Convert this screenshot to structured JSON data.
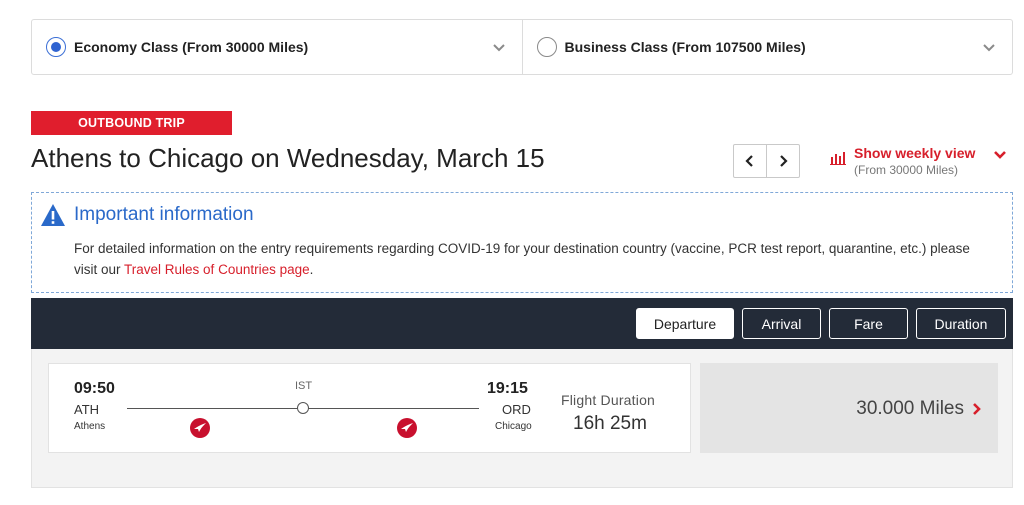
{
  "cabin": {
    "economy_label": "Economy Class (From 30000 Miles)",
    "business_label": "Business Class (From 107500 Miles)",
    "selected": "economy"
  },
  "trip": {
    "tag": "OUTBOUND TRIP",
    "title": "Athens to Chicago on Wednesday, March 15"
  },
  "weekly": {
    "label": "Show weekly view",
    "sub": "(From 30000 Miles)"
  },
  "info": {
    "title": "Important information",
    "body_part1": "For detailed information on the entry requirements regarding COVID-19 for your destination country (vaccine, PCR test report, quarantine, etc.) please visit our ",
    "link_text": "Travel Rules of Countries page",
    "body_part2": "."
  },
  "sort": {
    "buttons": [
      "Departure",
      "Arrival",
      "Fare",
      "Duration"
    ],
    "active": "Departure"
  },
  "flight": {
    "dep_time": "09:50",
    "dep_code": "ATH",
    "dep_city": "Athens",
    "stop": "IST",
    "arr_time": "19:15",
    "arr_code": "ORD",
    "arr_city": "Chicago",
    "duration_label": "Flight Duration",
    "duration": "16h 25m",
    "price": "30.000 Miles"
  },
  "colors": {
    "brand_red": "#e01e2d",
    "info_blue": "#2a69c9",
    "sort_bar": "#232b38"
  }
}
